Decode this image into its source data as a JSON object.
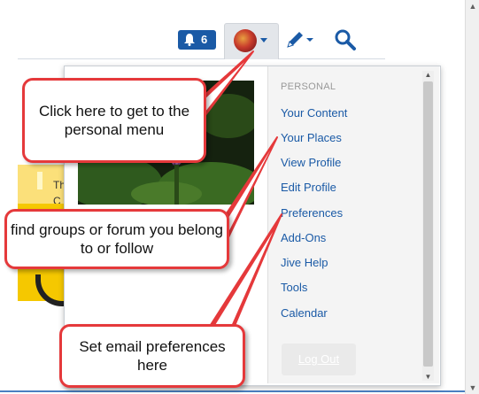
{
  "header": {
    "notification_count": "6",
    "icons": {
      "notifications": "bell-icon",
      "avatar": "user-avatar",
      "avatar_caret": "chevron-down-icon",
      "create": "pencil-icon",
      "create_caret": "chevron-down-icon",
      "search": "search-icon"
    },
    "accent_color": "#1a5aa6"
  },
  "background_page": {
    "fragment_chars": [
      "Th",
      "C"
    ]
  },
  "personal_menu": {
    "section_label": "PERSONAL",
    "items": [
      {
        "label": "Your Content"
      },
      {
        "label": "Your Places"
      },
      {
        "label": "View Profile"
      },
      {
        "label": "Edit Profile"
      },
      {
        "label": "Preferences"
      },
      {
        "label": "Add-Ons"
      },
      {
        "label": "Jive Help"
      },
      {
        "label": "Tools"
      },
      {
        "label": "Calendar"
      }
    ],
    "logout_label": "Log Out"
  },
  "callouts": {
    "personal_menu": "Click here to get to the personal menu",
    "places": "find groups or forum you belong to or follow",
    "preferences": "Set email preferences here",
    "border_color": "#e5393b"
  }
}
